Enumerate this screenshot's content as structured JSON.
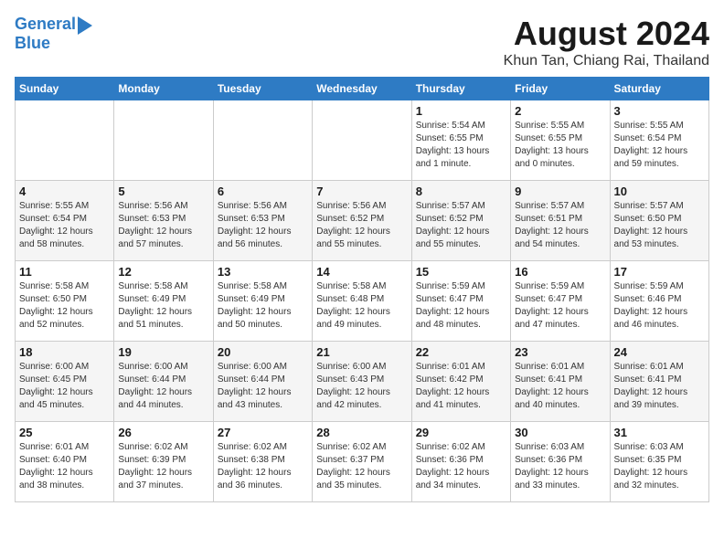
{
  "logo": {
    "line1": "General",
    "line2": "Blue"
  },
  "title": "August 2024",
  "location": "Khun Tan, Chiang Rai, Thailand",
  "headers": [
    "Sunday",
    "Monday",
    "Tuesday",
    "Wednesday",
    "Thursday",
    "Friday",
    "Saturday"
  ],
  "weeks": [
    [
      {
        "day": "",
        "info": ""
      },
      {
        "day": "",
        "info": ""
      },
      {
        "day": "",
        "info": ""
      },
      {
        "day": "",
        "info": ""
      },
      {
        "day": "1",
        "info": "Sunrise: 5:54 AM\nSunset: 6:55 PM\nDaylight: 13 hours\nand 1 minute."
      },
      {
        "day": "2",
        "info": "Sunrise: 5:55 AM\nSunset: 6:55 PM\nDaylight: 13 hours\nand 0 minutes."
      },
      {
        "day": "3",
        "info": "Sunrise: 5:55 AM\nSunset: 6:54 PM\nDaylight: 12 hours\nand 59 minutes."
      }
    ],
    [
      {
        "day": "4",
        "info": "Sunrise: 5:55 AM\nSunset: 6:54 PM\nDaylight: 12 hours\nand 58 minutes."
      },
      {
        "day": "5",
        "info": "Sunrise: 5:56 AM\nSunset: 6:53 PM\nDaylight: 12 hours\nand 57 minutes."
      },
      {
        "day": "6",
        "info": "Sunrise: 5:56 AM\nSunset: 6:53 PM\nDaylight: 12 hours\nand 56 minutes."
      },
      {
        "day": "7",
        "info": "Sunrise: 5:56 AM\nSunset: 6:52 PM\nDaylight: 12 hours\nand 55 minutes."
      },
      {
        "day": "8",
        "info": "Sunrise: 5:57 AM\nSunset: 6:52 PM\nDaylight: 12 hours\nand 55 minutes."
      },
      {
        "day": "9",
        "info": "Sunrise: 5:57 AM\nSunset: 6:51 PM\nDaylight: 12 hours\nand 54 minutes."
      },
      {
        "day": "10",
        "info": "Sunrise: 5:57 AM\nSunset: 6:50 PM\nDaylight: 12 hours\nand 53 minutes."
      }
    ],
    [
      {
        "day": "11",
        "info": "Sunrise: 5:58 AM\nSunset: 6:50 PM\nDaylight: 12 hours\nand 52 minutes."
      },
      {
        "day": "12",
        "info": "Sunrise: 5:58 AM\nSunset: 6:49 PM\nDaylight: 12 hours\nand 51 minutes."
      },
      {
        "day": "13",
        "info": "Sunrise: 5:58 AM\nSunset: 6:49 PM\nDaylight: 12 hours\nand 50 minutes."
      },
      {
        "day": "14",
        "info": "Sunrise: 5:58 AM\nSunset: 6:48 PM\nDaylight: 12 hours\nand 49 minutes."
      },
      {
        "day": "15",
        "info": "Sunrise: 5:59 AM\nSunset: 6:47 PM\nDaylight: 12 hours\nand 48 minutes."
      },
      {
        "day": "16",
        "info": "Sunrise: 5:59 AM\nSunset: 6:47 PM\nDaylight: 12 hours\nand 47 minutes."
      },
      {
        "day": "17",
        "info": "Sunrise: 5:59 AM\nSunset: 6:46 PM\nDaylight: 12 hours\nand 46 minutes."
      }
    ],
    [
      {
        "day": "18",
        "info": "Sunrise: 6:00 AM\nSunset: 6:45 PM\nDaylight: 12 hours\nand 45 minutes."
      },
      {
        "day": "19",
        "info": "Sunrise: 6:00 AM\nSunset: 6:44 PM\nDaylight: 12 hours\nand 44 minutes."
      },
      {
        "day": "20",
        "info": "Sunrise: 6:00 AM\nSunset: 6:44 PM\nDaylight: 12 hours\nand 43 minutes."
      },
      {
        "day": "21",
        "info": "Sunrise: 6:00 AM\nSunset: 6:43 PM\nDaylight: 12 hours\nand 42 minutes."
      },
      {
        "day": "22",
        "info": "Sunrise: 6:01 AM\nSunset: 6:42 PM\nDaylight: 12 hours\nand 41 minutes."
      },
      {
        "day": "23",
        "info": "Sunrise: 6:01 AM\nSunset: 6:41 PM\nDaylight: 12 hours\nand 40 minutes."
      },
      {
        "day": "24",
        "info": "Sunrise: 6:01 AM\nSunset: 6:41 PM\nDaylight: 12 hours\nand 39 minutes."
      }
    ],
    [
      {
        "day": "25",
        "info": "Sunrise: 6:01 AM\nSunset: 6:40 PM\nDaylight: 12 hours\nand 38 minutes."
      },
      {
        "day": "26",
        "info": "Sunrise: 6:02 AM\nSunset: 6:39 PM\nDaylight: 12 hours\nand 37 minutes."
      },
      {
        "day": "27",
        "info": "Sunrise: 6:02 AM\nSunset: 6:38 PM\nDaylight: 12 hours\nand 36 minutes."
      },
      {
        "day": "28",
        "info": "Sunrise: 6:02 AM\nSunset: 6:37 PM\nDaylight: 12 hours\nand 35 minutes."
      },
      {
        "day": "29",
        "info": "Sunrise: 6:02 AM\nSunset: 6:36 PM\nDaylight: 12 hours\nand 34 minutes."
      },
      {
        "day": "30",
        "info": "Sunrise: 6:03 AM\nSunset: 6:36 PM\nDaylight: 12 hours\nand 33 minutes."
      },
      {
        "day": "31",
        "info": "Sunrise: 6:03 AM\nSunset: 6:35 PM\nDaylight: 12 hours\nand 32 minutes."
      }
    ]
  ]
}
